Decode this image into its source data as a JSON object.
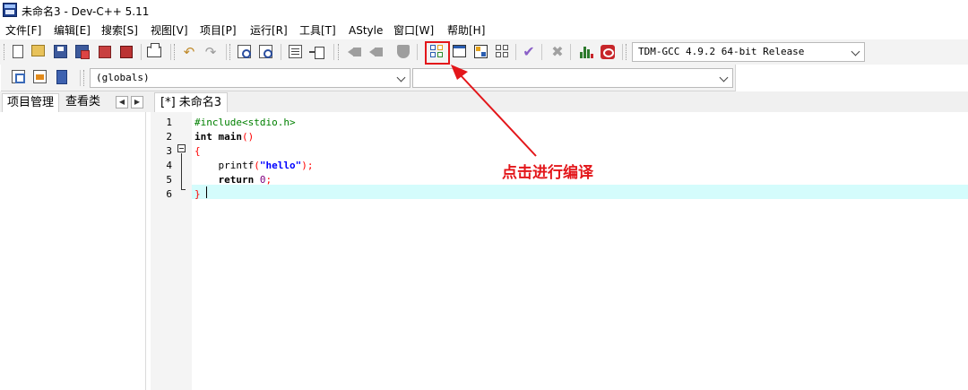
{
  "window": {
    "title": "未命名3 - Dev-C++ 5.11"
  },
  "menu": [
    "文件[F]",
    "编辑[E]",
    "搜索[S]",
    "视图[V]",
    "项目[P]",
    "运行[R]",
    "工具[T]",
    "AStyle",
    "窗口[W]",
    "帮助[H]"
  ],
  "toolbar": {
    "compiler_select": "TDM-GCC 4.9.2 64-bit Release",
    "globals_select": "(globals)",
    "members_select": ""
  },
  "left_panel": {
    "tabs": [
      "项目管理",
      "查看类"
    ]
  },
  "editor": {
    "tab_label": "[*] 未命名3",
    "line_numbers": [
      "1",
      "2",
      "3",
      "4",
      "5",
      "6"
    ],
    "code": {
      "l1": "#include<stdio.h>",
      "l2_kw": "int",
      "l2_rest": " main",
      "l2_paren": "()",
      "l3": "{",
      "l4_fn": "    printf",
      "l4_open": "(",
      "l4_str": "\"hello\"",
      "l4_close": ");",
      "l5_kw": "    return",
      "l5_num": "0",
      "l5_end": ";",
      "l6": "}"
    }
  },
  "annotation": {
    "text": "点击进行编译",
    "color": "#e3161a"
  },
  "icons": [
    "new-file-icon",
    "open-icon",
    "save-icon",
    "save-all-icon",
    "close-icon",
    "close-all-icon",
    "print-icon",
    "undo-icon",
    "redo-icon",
    "find-icon",
    "goto-icon",
    "indent-icon",
    "unindent-icon",
    "compile-icon",
    "run-icon",
    "compile-run-icon",
    "rebuild-icon",
    "syntax-check-icon",
    "stop-icon",
    "chart-icon",
    "profile-icon"
  ]
}
